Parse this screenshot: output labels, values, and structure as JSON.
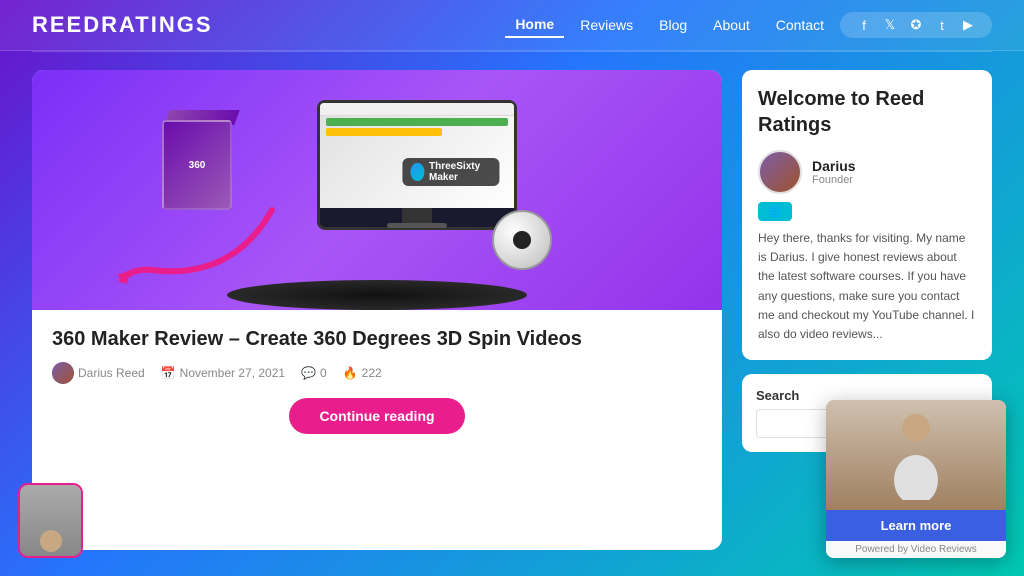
{
  "header": {
    "logo": "ReedRatings",
    "nav": {
      "items": [
        {
          "label": "Home",
          "active": true
        },
        {
          "label": "Reviews",
          "active": false
        },
        {
          "label": "Blog",
          "active": false
        },
        {
          "label": "About",
          "active": false
        },
        {
          "label": "Contact",
          "active": false
        }
      ]
    },
    "social": {
      "icons": [
        "f",
        "t",
        "p",
        "t",
        "yt"
      ]
    }
  },
  "article": {
    "title": "360 Maker Review – Create 360 Degrees 3D Spin Videos",
    "author": "Darius Reed",
    "date": "November 27, 2021",
    "comments": "0",
    "views": "222",
    "continue_button": "Continue reading",
    "image_alt": "360 Maker product image with monitor"
  },
  "sidebar": {
    "welcome_title": "Welcome to Reed Ratings",
    "author_name": "Darius",
    "author_role": "Founder",
    "author_link_label": "🌐",
    "description": "Hey there, thanks for visiting. My name is Darius. I give honest reviews about the latest software courses. If you have any questions, make sure you contact me and checkout my YouTube channel. I also do video reviews...",
    "search": {
      "label": "Search",
      "placeholder": ""
    }
  },
  "video_popup": {
    "learn_more_label": "Learn more",
    "powered_by": "Powered by Video Reviews"
  }
}
